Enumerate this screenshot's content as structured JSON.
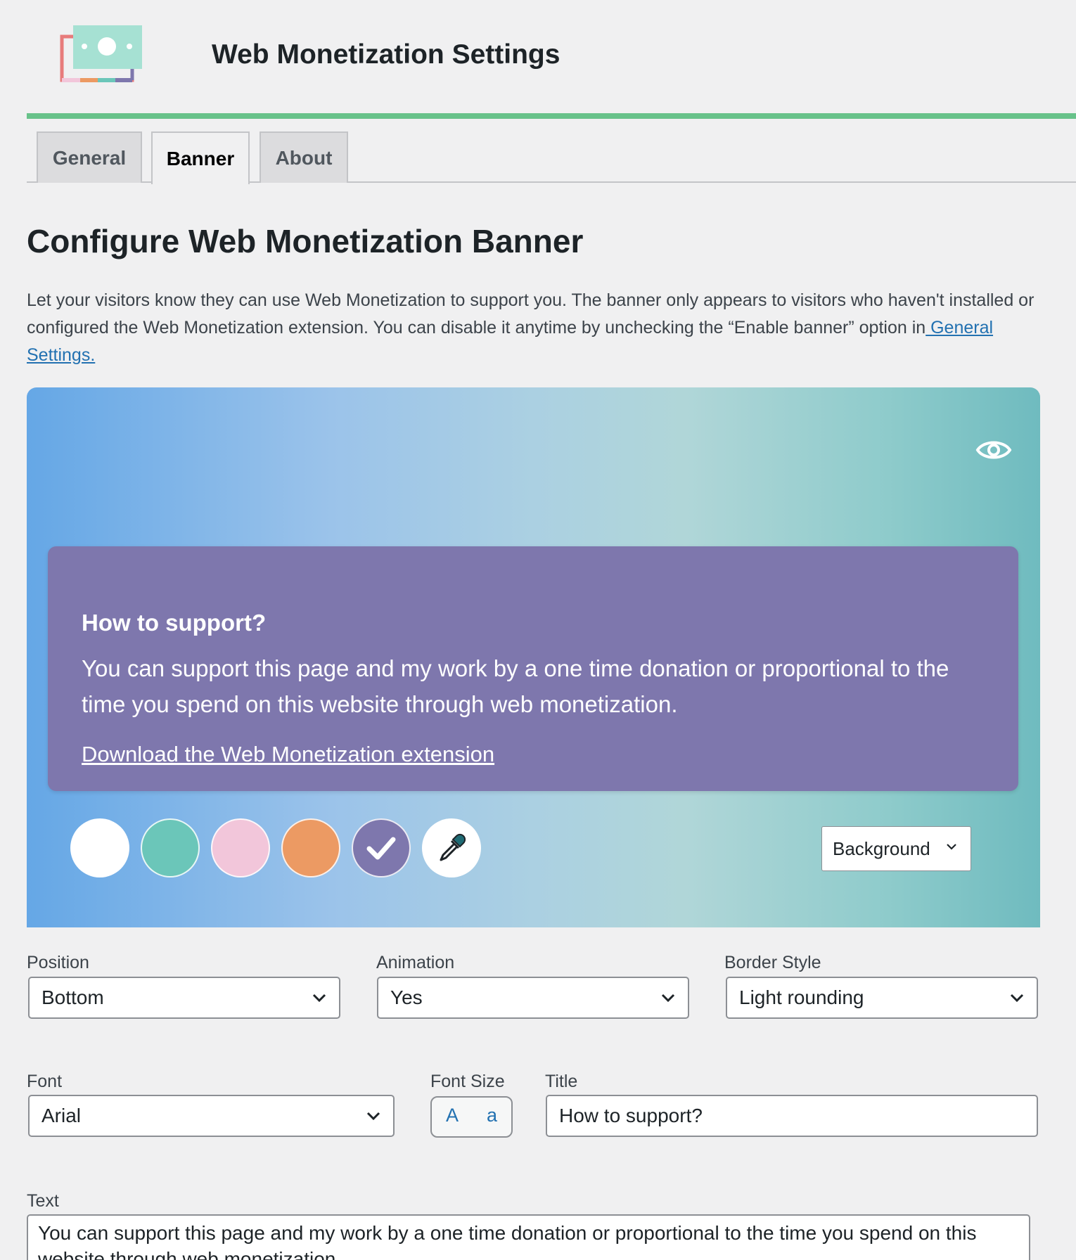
{
  "header": {
    "logo_icon": "money-banknote-icon",
    "title": "Web Monetization Settings"
  },
  "tabs": [
    {
      "label": "General",
      "active": false
    },
    {
      "label": "Banner",
      "active": true
    },
    {
      "label": "About",
      "active": false
    }
  ],
  "page": {
    "title": "Configure Web Monetization Banner",
    "intro_text": "Let your visitors know they can use Web Monetization to support you. The banner only appears to visitors who haven't installed or configured the Web Monetization extension. You can disable it anytime by unchecking the “Enable banner” option in",
    "intro_link": " General Settings."
  },
  "preview": {
    "toggle_icon": "eye-icon",
    "banner": {
      "title": "How to support?",
      "text": "You can support this page and my work by a one time donation or proportional to the time you spend on this website through web monetization.",
      "link": "Download the Web Monetization extension"
    },
    "swatches": [
      {
        "color": "#ffffff",
        "selected": false
      },
      {
        "color": "#6bc6b9",
        "selected": false
      },
      {
        "color": "#f2c6da",
        "selected": false
      },
      {
        "color": "#ec9a63",
        "selected": false
      },
      {
        "color": "#7e77ad",
        "selected": true
      }
    ],
    "picker_icon": "eyedropper-icon",
    "target_select": "Background"
  },
  "fields": {
    "position": {
      "label": "Position",
      "value": "Bottom"
    },
    "animation": {
      "label": "Animation",
      "value": "Yes"
    },
    "border_style": {
      "label": "Border Style",
      "value": "Light rounding"
    },
    "font": {
      "label": "Font",
      "value": "Arial"
    },
    "font_size": {
      "label": "Font Size",
      "increase": "A",
      "decrease": "a"
    },
    "title": {
      "label": "Title",
      "value": "How to support?"
    },
    "text": {
      "label": "Text",
      "value": "You can support this page and my work by a one time donation or proportional to the time you spend on this website through web monetization."
    }
  },
  "colors": {
    "accent_rule": "#68c28a",
    "link": "#2271b1",
    "banner_background": "#7e77ad"
  }
}
